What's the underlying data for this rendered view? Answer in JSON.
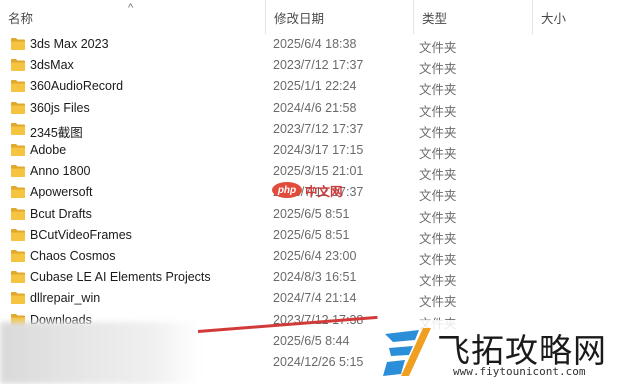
{
  "columns": {
    "name": "名称",
    "date": "修改日期",
    "type": "类型",
    "size": "大小"
  },
  "sort_indicator": "^",
  "rows": [
    {
      "name": "3ds Max 2023",
      "date": "2025/6/4 18:38",
      "type": "文件夹"
    },
    {
      "name": "3dsMax",
      "date": "2023/7/12 17:37",
      "type": "文件夹"
    },
    {
      "name": "360AudioRecord",
      "date": "2025/1/1 22:24",
      "type": "文件夹"
    },
    {
      "name": "360js Files",
      "date": "2024/4/6 21:58",
      "type": "文件夹"
    },
    {
      "name": "2345截图",
      "date": "2023/7/12 17:37",
      "type": "文件夹"
    },
    {
      "name": "Adobe",
      "date": "2024/3/17 17:15",
      "type": "文件夹"
    },
    {
      "name": "Anno 1800",
      "date": "2025/3/15 21:01",
      "type": "文件夹"
    },
    {
      "name": "Apowersoft",
      "date": "2023/7/12 17:37",
      "type": "文件夹"
    },
    {
      "name": "Bcut Drafts",
      "date": "2025/6/5 8:51",
      "type": "文件夹"
    },
    {
      "name": "BCutVideoFrames",
      "date": "2025/6/5 8:51",
      "type": "文件夹"
    },
    {
      "name": "Chaos Cosmos",
      "date": "2025/6/4 23:00",
      "type": "文件夹"
    },
    {
      "name": "Cubase LE AI Elements Projects",
      "date": "2024/8/3 16:51",
      "type": "文件夹"
    },
    {
      "name": "dllrepair_win",
      "date": "2024/7/4 21:14",
      "type": "文件夹"
    },
    {
      "name": "Downloads",
      "date": "2023/7/12 17:38",
      "type": "文件夹"
    },
    {
      "name": "",
      "date": "2025/6/5 8:44",
      "type": ""
    },
    {
      "name": "",
      "date": "2024/12/26 5:15",
      "type": ""
    }
  ],
  "colors": {
    "folder": "#f5c542",
    "folder_dark": "#e0a82e",
    "accent_red": "#d23a3a"
  },
  "watermarks": {
    "php_badge": "php",
    "php_text": "中文网",
    "site_name": "飞拓攻略网",
    "site_url": "www.fiytounicont.com"
  }
}
